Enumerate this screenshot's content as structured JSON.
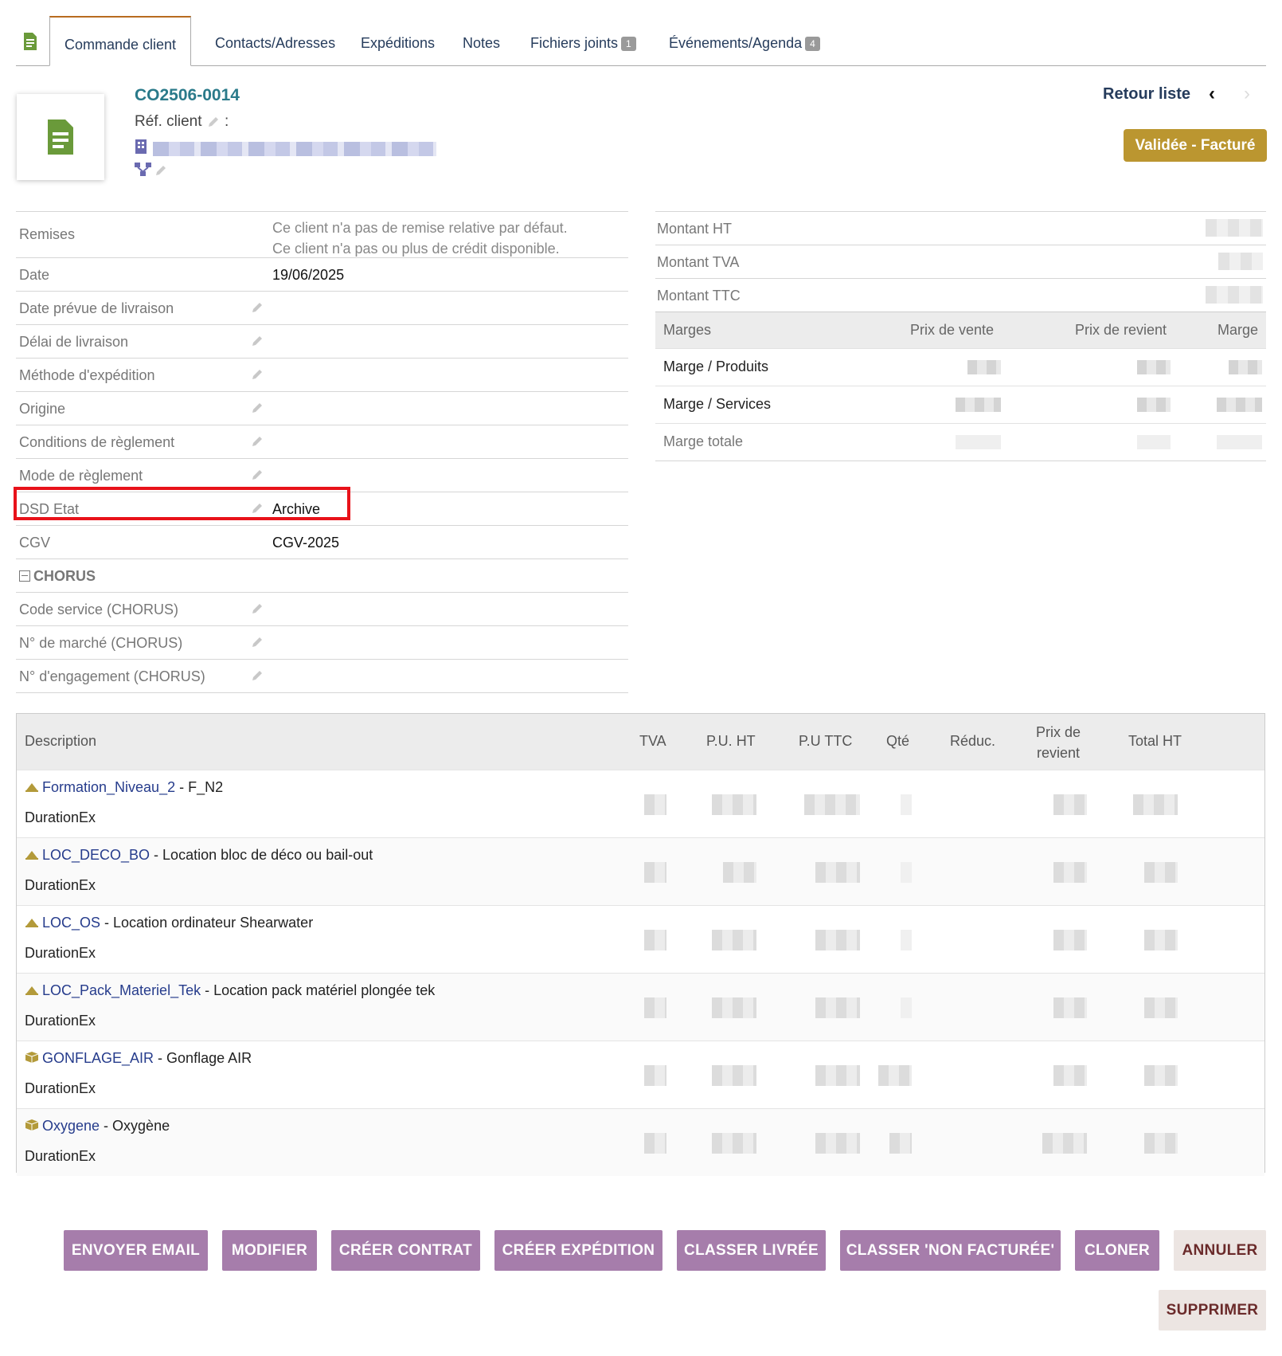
{
  "tabs": [
    {
      "label": "Commande client",
      "badge": ""
    },
    {
      "label": "Contacts/Adresses",
      "badge": ""
    },
    {
      "label": "Expéditions",
      "badge": ""
    },
    {
      "label": "Notes",
      "badge": ""
    },
    {
      "label": "Fichiers joints",
      "badge": "1"
    },
    {
      "label": "Événements/Agenda",
      "badge": "4"
    }
  ],
  "header": {
    "ref": "CO2506-0014",
    "ref_client_label": "Réf. client",
    "ref_client_sep": ":",
    "back_label": "Retour liste",
    "prev_icon": "‹",
    "next_icon": "›",
    "status": "Validée - Facturé"
  },
  "fields": {
    "remises": {
      "label": "Remises",
      "line1": "Ce client n'a pas de remise relative par défaut.",
      "line2": "Ce client n'a pas ou plus de crédit disponible."
    },
    "date": {
      "label": "Date",
      "value": "19/06/2025"
    },
    "date_livraison": {
      "label": "Date prévue de livraison"
    },
    "delai": {
      "label": "Délai de livraison"
    },
    "methode": {
      "label": "Méthode d'expédition"
    },
    "origine": {
      "label": "Origine"
    },
    "conditions": {
      "label": "Conditions de règlement"
    },
    "mode": {
      "label": "Mode de règlement"
    },
    "dsd": {
      "label": "DSD Etat",
      "value": "Archive"
    },
    "cgv": {
      "label": "CGV",
      "value": "CGV-2025"
    },
    "chorus": {
      "label": "CHORUS"
    },
    "code_service": {
      "label": "Code service (CHORUS)"
    },
    "marche": {
      "label": "N° de marché (CHORUS)"
    },
    "engagement": {
      "label": "N° d'engagement (CHORUS)"
    }
  },
  "amounts": {
    "ht": "Montant HT",
    "tva": "Montant TVA",
    "ttc": "Montant TTC"
  },
  "margins": {
    "headers": [
      "Marges",
      "Prix de vente",
      "Prix de revient",
      "Marge"
    ],
    "rows": [
      "Marge / Produits",
      "Marge / Services",
      "Marge totale"
    ]
  },
  "lines_table": {
    "headers": {
      "description": "Description",
      "tva": "TVA",
      "pu_ht": "P.U. HT",
      "pu_ttc": "P.U TTC",
      "qte": "Qté",
      "reduc": "Réduc.",
      "prix_revient_1": "Prix de",
      "prix_revient_2": "revient",
      "total_ht": "Total HT"
    },
    "rows": [
      {
        "code": "Formation_Niveau_2",
        "label": " - F_N2",
        "sub": "DurationEx",
        "kind": "service"
      },
      {
        "code": "LOC_DECO_BO",
        "label": " - Location bloc de déco ou bail-out",
        "sub": "DurationEx",
        "kind": "service"
      },
      {
        "code": "LOC_OS",
        "label": " - Location ordinateur Shearwater",
        "sub": "DurationEx",
        "kind": "service"
      },
      {
        "code": "LOC_Pack_Materiel_Tek",
        "label": " - Location pack matériel plongée tek",
        "sub": "DurationEx",
        "kind": "service"
      },
      {
        "code": "GONFLAGE_AIR",
        "label": " - Gonflage AIR",
        "sub": "DurationEx",
        "kind": "product"
      },
      {
        "code": "Oxygene",
        "label": " - Oxygène",
        "sub": "DurationEx",
        "kind": "product"
      }
    ]
  },
  "buttons": {
    "email": "ENVOYER EMAIL",
    "modifier": "MODIFIER",
    "contrat": "CRÉER CONTRAT",
    "expedition": "CRÉER EXPÉDITION",
    "livree": "CLASSER LIVRÉE",
    "non_facturee": "CLASSER 'NON FACTURÉE'",
    "cloner": "CLONER",
    "annuler": "ANNULER",
    "supprimer": "SUPPRIMER"
  },
  "colors": {
    "status_bg": "#bb9630",
    "action_button": "#a67dab",
    "highlight_border": "#e8121a",
    "link": "#263c8c"
  }
}
